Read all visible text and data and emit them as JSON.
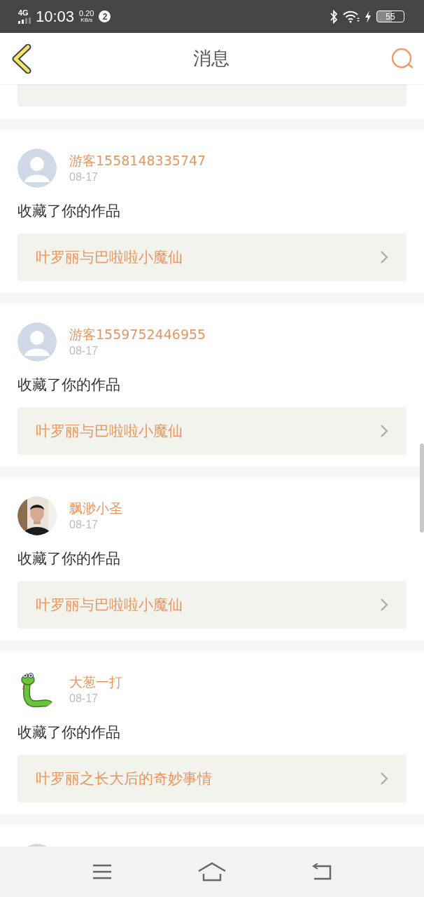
{
  "status_bar": {
    "network": "4G",
    "time": "10:03",
    "speed_value": "0.20",
    "speed_unit": "KB/s",
    "notification_count": "2",
    "battery": "55"
  },
  "header": {
    "title": "消息"
  },
  "partial_top_card": {
    "kind": "link"
  },
  "messages": [
    {
      "user": "游客1558148335747",
      "date": "08-17",
      "action": "收藏了你的作品",
      "work": "叶罗丽与巴啦啦小魔仙",
      "avatar": {
        "kind": "default"
      }
    },
    {
      "user": "游客1559752446955",
      "date": "08-17",
      "action": "收藏了你的作品",
      "work": "叶罗丽与巴啦啦小魔仙",
      "avatar": {
        "kind": "default"
      }
    },
    {
      "user": "飘渺小圣",
      "date": "08-17",
      "action": "收藏了你的作品",
      "work": "叶罗丽与巴啦啦小魔仙"
    },
    {
      "user": "大葱一打",
      "date": "08-17",
      "action": "收藏了你的作品",
      "work": "叶罗丽之长大后的奇妙事情",
      "avatar": {
        "kind": "cartoon"
      }
    }
  ],
  "partial_bottom_message": {
    "avatar": {
      "kind": "default"
    }
  }
}
